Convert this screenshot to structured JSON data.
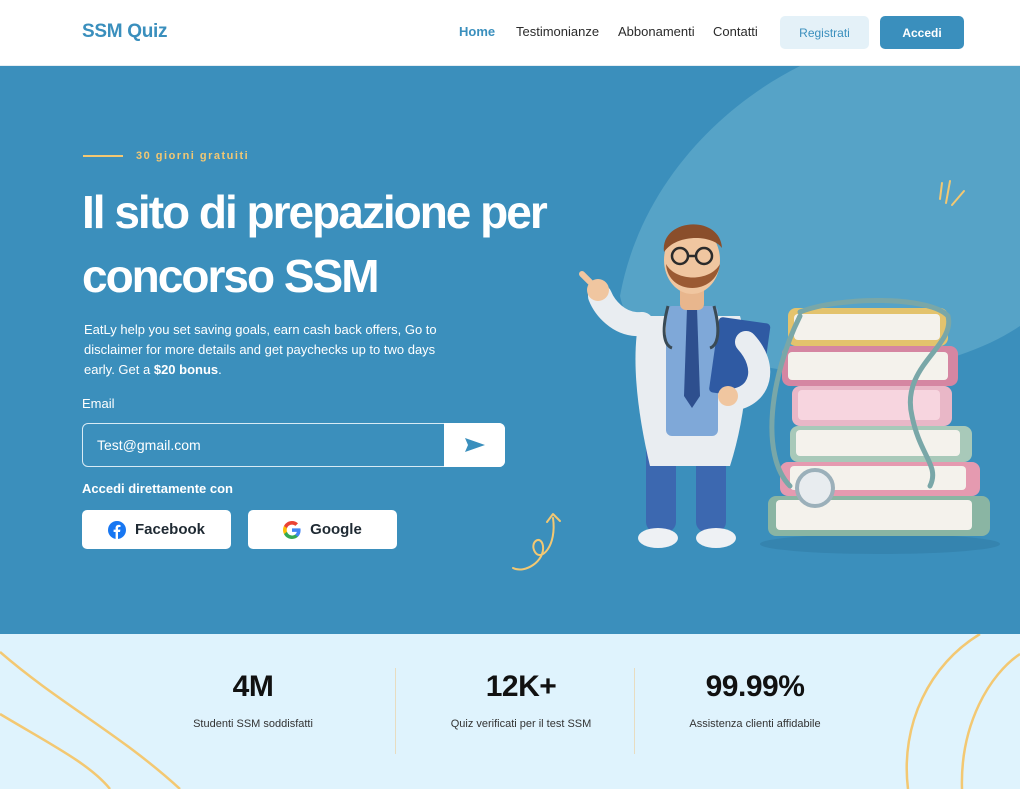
{
  "header": {
    "logo": "SSM Quiz",
    "nav": [
      "Home",
      "Testimonianze",
      "Abbonamenti",
      "Contatti"
    ],
    "register_label": "Registrati",
    "login_label": "Accedi"
  },
  "hero": {
    "tagline": "30 giorni gratuiti",
    "title": "Il sito di prepazione per concorso SSM",
    "description_main": "EatLy help you set saving goals, earn cash back offers, Go to disclaimer for more details and get paychecks up to two days early. Get a ",
    "description_bold": "$20 bonus",
    "description_end": ".",
    "email_label": "Email",
    "email_value": "Test@gmail.com",
    "social_label": "Accedi direttamente con",
    "facebook_label": "Facebook",
    "google_label": "Google"
  },
  "stats": [
    {
      "value": "4M",
      "label": "Studenti SSM soddisfatti"
    },
    {
      "value": "12K+",
      "label": "Quiz verificati per il test SSM"
    },
    {
      "value": "99.99%",
      "label": "Assistenza clienti affidabile"
    }
  ],
  "colors": {
    "brand": "#3a8fbd",
    "hero_bg": "#3b8fbc",
    "accent_yellow": "#f3c872",
    "stats_bg": "#dff3fd"
  },
  "icons": {
    "send": "send-arrow-icon",
    "facebook": "facebook-icon",
    "google": "google-icon"
  }
}
